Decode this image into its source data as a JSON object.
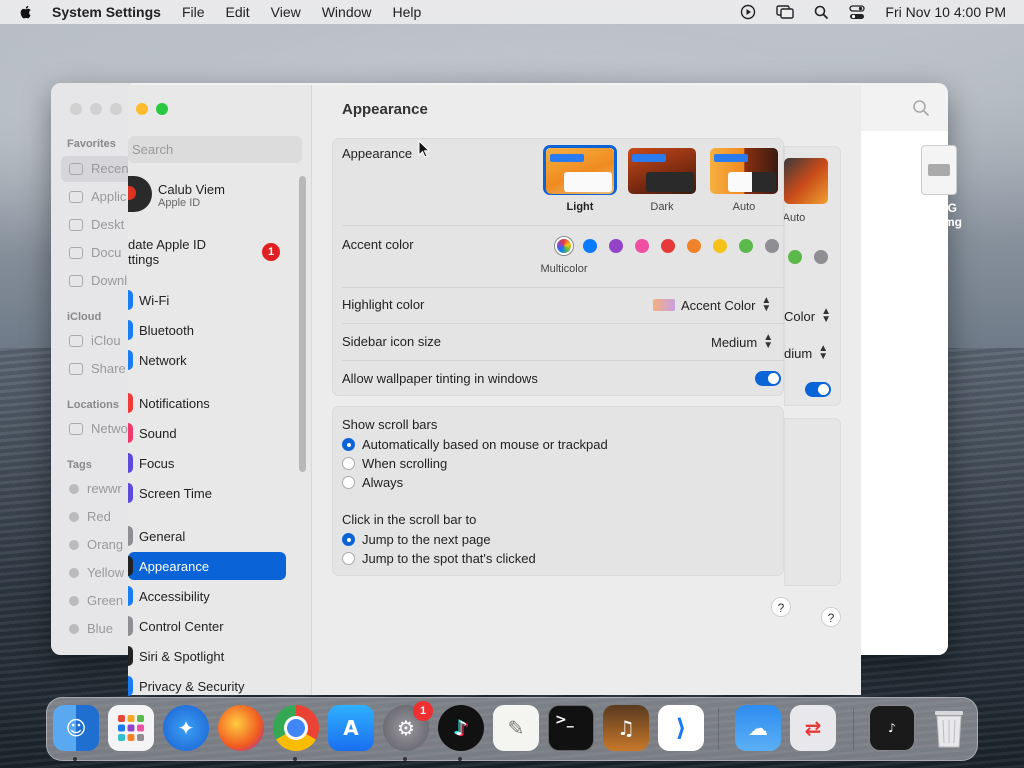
{
  "menubar": {
    "app_name": "System Settings",
    "menus": [
      "File",
      "Edit",
      "View",
      "Window",
      "Help"
    ],
    "clock": "Fri Nov 10  4:00 PM"
  },
  "finder": {
    "sections": [
      "Favorites",
      "iCloud",
      "Locations",
      "Tags"
    ],
    "favorites": [
      "Recen",
      "Applic",
      "Deskt",
      "Docu",
      "Downl"
    ],
    "icloud": [
      "iClou",
      "Share"
    ],
    "locations": [
      "Netwo"
    ],
    "tags": [
      "rewwr",
      "Red",
      "Orang",
      "Yellow",
      "Green",
      "Blue"
    ],
    "file_label_1": "WTSG",
    "file_label_2": "me.dmg"
  },
  "settings": {
    "search_placeholder": "Search",
    "user_name": "Calub Viem",
    "user_sub": "Apple ID",
    "update_line1": "date Apple ID",
    "update_line2": "ttings",
    "update_badge": "1",
    "sidebar_items": [
      "Wi-Fi",
      "Bluetooth",
      "Network",
      "Notifications",
      "Sound",
      "Focus",
      "Screen Time",
      "General",
      "Appearance",
      "Accessibility",
      "Control Center",
      "Siri & Spotlight",
      "Privacy & Security"
    ],
    "sidebar_colors": [
      "#1a7cf5",
      "#1a7cf5",
      "#1a7cf5",
      "#f03a3a",
      "#ee3a6a",
      "#5d4ad8",
      "#5d4ad8",
      "#8e8e93",
      "#222222",
      "#1a7cf5",
      "#8e8e93",
      "#222222",
      "#1a7cf5"
    ],
    "page_title": "Appearance",
    "appearance_label": "Appearance",
    "appearance_options": [
      "Light",
      "Dark",
      "Auto"
    ],
    "ghost_auto": "Auto",
    "accent_label": "Accent color",
    "accent_colors": [
      "#0a7aff",
      "#9444c8",
      "#ee4fa0",
      "#e63a3a",
      "#f0822a",
      "#f5c318",
      "#5bb84a",
      "#8e8e93"
    ],
    "accent_selected_name": "Multicolor",
    "highlight_label": "Highlight color",
    "highlight_value": "Accent Color",
    "ghost_highlight": "Color",
    "sidebar_icon_label": "Sidebar icon size",
    "sidebar_icon_value": "Medium",
    "ghost_sidebar_icon": "dium",
    "tinting_label": "Allow wallpaper tinting in windows",
    "tinting_on": true,
    "scroll_title": "Show scroll bars",
    "scroll_options": [
      "Automatically based on mouse or trackpad",
      "When scrolling",
      "Always"
    ],
    "click_title": "Click in the scroll bar to",
    "click_options": [
      "Jump to the next page",
      "Jump to the spot that's clicked"
    ],
    "help": "?"
  },
  "dock": {
    "apps": [
      "Finder",
      "Launchpad",
      "Safari",
      "Firefox",
      "Chrome",
      "App Store",
      "System Settings",
      "TikTok",
      "TextEdit",
      "Terminal",
      "GarageBand",
      "VS Code",
      "Weather",
      "Migration",
      "Screenshot",
      "Trash"
    ],
    "settings_badge": "1"
  }
}
